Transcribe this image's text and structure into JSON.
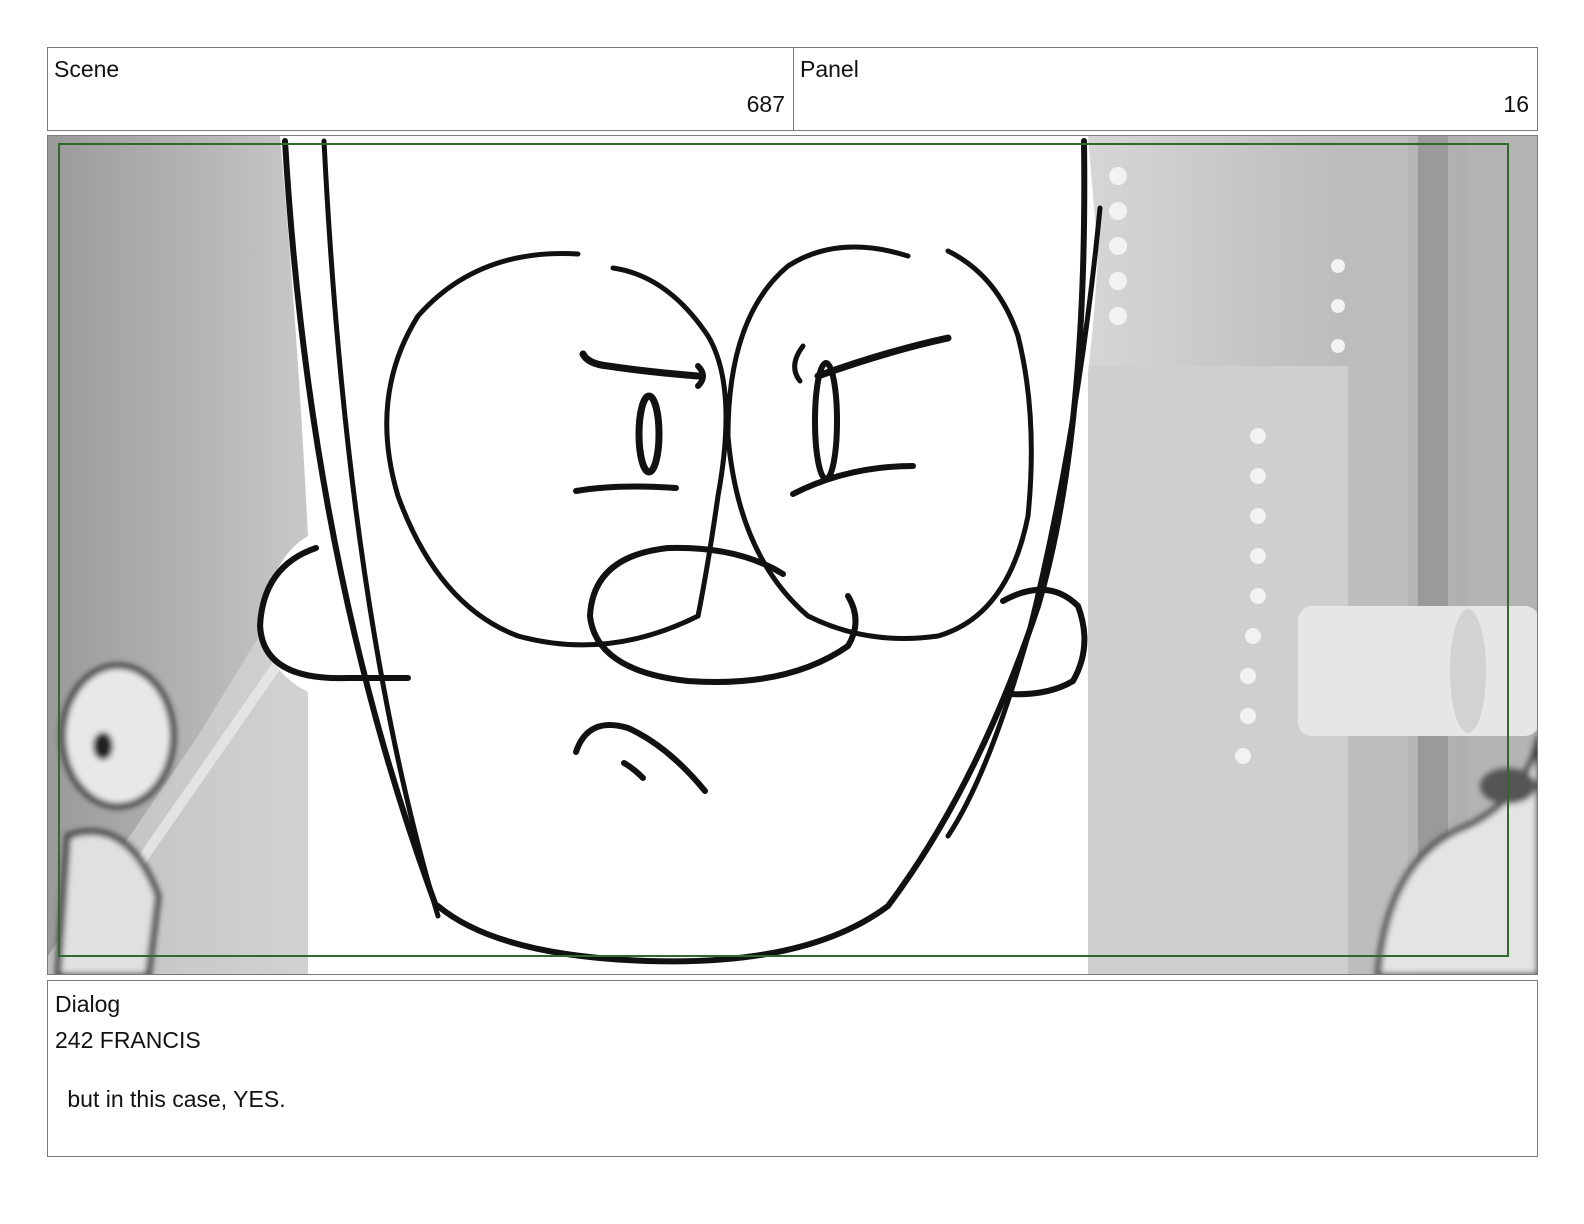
{
  "header": {
    "scene_label": "Scene",
    "scene_number": "687",
    "panel_label": "Panel",
    "panel_number": "16"
  },
  "frame": {
    "description_icon": "storyboard-sketch-face",
    "safe_area_color": "#2e6b2a"
  },
  "dialog": {
    "label": "Dialog",
    "speaker": "242 FRANCIS",
    "line": " but in this case, YES."
  }
}
